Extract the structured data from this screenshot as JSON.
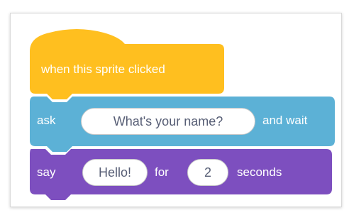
{
  "blocks": {
    "event": {
      "label": "when this sprite clicked",
      "color": "#ffbf1f"
    },
    "ask": {
      "prefix": "ask",
      "input_value": "What's your name?",
      "suffix": "and wait",
      "color": "#5cb1d6"
    },
    "say": {
      "prefix": "say",
      "message_value": "Hello!",
      "middle": "for",
      "seconds_value": "2",
      "suffix": "seconds",
      "color": "#7d4fbf"
    }
  }
}
